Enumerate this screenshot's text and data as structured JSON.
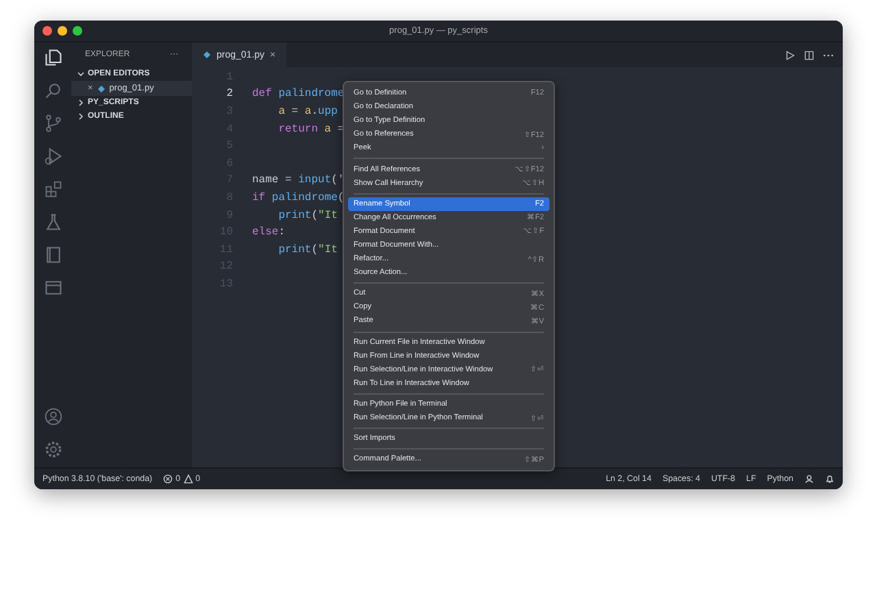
{
  "window": {
    "title": "prog_01.py — py_scripts"
  },
  "sidebar": {
    "title": "EXPLORER",
    "more": "···",
    "sections": [
      {
        "label": "OPEN EDITORS",
        "expanded": true,
        "items": [
          {
            "close": "×",
            "name": "prog_01.py"
          }
        ]
      },
      {
        "label": "PY_SCRIPTS",
        "expanded": false
      },
      {
        "label": "OUTLINE",
        "expanded": false
      }
    ]
  },
  "tabs": [
    {
      "label": "prog_01.py",
      "close": "×",
      "selected": true
    }
  ],
  "editor": {
    "lines": [
      {
        "number": "1",
        "active": false
      },
      {
        "number": "2",
        "active": true,
        "indented": false,
        "tokens": [
          {
            "text": "def ",
            "kind": "keyword"
          },
          {
            "text": "palindrome",
            "kind": "function"
          }
        ]
      },
      {
        "number": "3",
        "active": false,
        "indented": true,
        "tokens": [
          {
            "text": "a",
            "kind": "variable"
          },
          {
            "text": " = ",
            "kind": "plain"
          },
          {
            "text": "a",
            "kind": "variable"
          },
          {
            "text": ".",
            "kind": "plain"
          },
          {
            "text": "upp",
            "kind": "function"
          }
        ]
      },
      {
        "number": "4",
        "active": false,
        "indented": true,
        "tokens": [
          {
            "text": "return ",
            "kind": "keyword"
          },
          {
            "text": "a",
            "kind": "variable"
          },
          {
            "text": " =",
            "kind": "plain"
          }
        ]
      },
      {
        "number": "5",
        "active": false
      },
      {
        "number": "6",
        "active": false
      },
      {
        "number": "7",
        "active": false,
        "indented": false,
        "tokens": [
          {
            "text": "name = ",
            "kind": "plain"
          },
          {
            "text": "input",
            "kind": "function"
          },
          {
            "text": "('",
            "kind": "plain"
          }
        ]
      },
      {
        "number": "8",
        "active": false,
        "indented": false,
        "tokens": [
          {
            "text": "if ",
            "kind": "keyword"
          },
          {
            "text": "palindrome",
            "kind": "function"
          },
          {
            "text": "(",
            "kind": "plain"
          }
        ]
      },
      {
        "number": "9",
        "active": false,
        "indented": true,
        "tokens": [
          {
            "text": "print",
            "kind": "function"
          },
          {
            "text": "(",
            "kind": "plain"
          },
          {
            "text": "\"It",
            "kind": "string"
          }
        ]
      },
      {
        "number": "10",
        "active": false,
        "indented": false,
        "tokens": [
          {
            "text": "else",
            "kind": "keyword"
          },
          {
            "text": ":",
            "kind": "plain"
          }
        ]
      },
      {
        "number": "11",
        "active": false,
        "indented": true,
        "tokens": [
          {
            "text": "print",
            "kind": "function"
          },
          {
            "text": "(",
            "kind": "plain"
          },
          {
            "text": "\"It",
            "kind": "string"
          }
        ]
      },
      {
        "number": "12",
        "active": false
      },
      {
        "number": "13",
        "active": false
      }
    ]
  },
  "context_menu": {
    "groups": [
      [
        {
          "label": "Go to Definition",
          "shortcut": "F12",
          "selected": false
        },
        {
          "label": "Go to Declaration",
          "selected": false
        },
        {
          "label": "Go to Type Definition",
          "selected": false
        },
        {
          "label": "Go to References",
          "shortcut": "⇧F12",
          "selected": false
        },
        {
          "label": "Peek",
          "shortcut": "›",
          "selected": false
        }
      ],
      [
        {
          "label": "Find All References",
          "shortcut": "⌥⇧F12",
          "selected": false
        },
        {
          "label": "Show Call Hierarchy",
          "shortcut": "⌥⇧H",
          "selected": false
        }
      ],
      [
        {
          "label": "Rename Symbol",
          "shortcut": "F2",
          "selected": true
        },
        {
          "label": "Change All Occurrences",
          "shortcut": "⌘F2",
          "selected": false
        },
        {
          "label": "Format Document",
          "shortcut": "⌥⇧F",
          "selected": false
        },
        {
          "label": "Format Document With...",
          "selected": false
        },
        {
          "label": "Refactor...",
          "shortcut": "^⇧R",
          "selected": false
        },
        {
          "label": "Source Action...",
          "selected": false
        }
      ],
      [
        {
          "label": "Cut",
          "shortcut": "⌘X",
          "selected": false
        },
        {
          "label": "Copy",
          "shortcut": "⌘C",
          "selected": false
        },
        {
          "label": "Paste",
          "shortcut": "⌘V",
          "selected": false
        }
      ],
      [
        {
          "label": "Run Current File in Interactive Window",
          "selected": false
        },
        {
          "label": "Run From Line in Interactive Window",
          "selected": false
        },
        {
          "label": "Run Selection/Line in Interactive Window",
          "shortcut": "⇧⏎",
          "selected": false
        },
        {
          "label": "Run To Line in Interactive Window",
          "selected": false
        }
      ],
      [
        {
          "label": "Run Python File in Terminal",
          "selected": false
        },
        {
          "label": "Run Selection/Line in Python Terminal",
          "shortcut": "⇧⏎",
          "selected": false
        }
      ],
      [
        {
          "label": "Sort Imports",
          "selected": false
        }
      ],
      [
        {
          "label": "Command Palette...",
          "shortcut": "⇧⌘P",
          "selected": false
        }
      ]
    ]
  },
  "status_bar": {
    "interpreter": "Python 3.8.10 ('base': conda)",
    "errors": "0",
    "warnings": "0",
    "position": "Ln 2, Col 14",
    "indent": "Spaces: 4",
    "encoding": "UTF-8",
    "eol": "LF",
    "language": "Python"
  }
}
